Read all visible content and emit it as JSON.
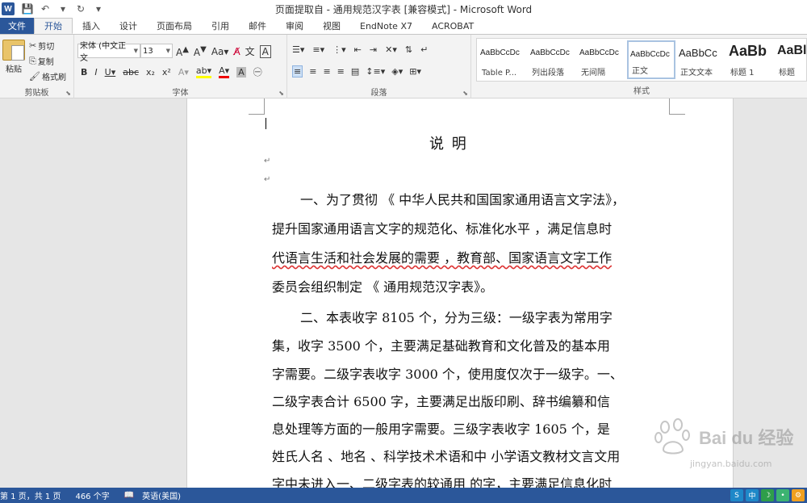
{
  "titlebar": {
    "title": "页面提取自 - 通用规范汉字表 [兼容模式] - Microsoft Word",
    "app_icon": "W"
  },
  "tabs": [
    "文件",
    "开始",
    "插入",
    "设计",
    "页面布局",
    "引用",
    "邮件",
    "审阅",
    "视图",
    "EndNote X7",
    "ACROBAT"
  ],
  "ribbon": {
    "clipboard": {
      "label": "剪贴板",
      "paste": "粘贴",
      "cut": "剪切",
      "copy": "复制",
      "format_painter": "格式刷"
    },
    "font": {
      "label": "字体",
      "font_name": "宋体 (中文正文",
      "font_size": "13"
    },
    "paragraph": {
      "label": "段落"
    },
    "styles": {
      "label": "样式",
      "items": [
        {
          "preview": "AaBbCcDc",
          "name": "Table P..."
        },
        {
          "preview": "AaBbCcDc",
          "name": "列出段落"
        },
        {
          "preview": "AaBbCcDc",
          "name": "无间隔"
        },
        {
          "preview": "AaBbCcDc",
          "name": "正文"
        },
        {
          "preview": "AaBbCc",
          "name": "正文文本"
        },
        {
          "preview": "AaBb",
          "name": "标题 1"
        },
        {
          "preview": "AaBl",
          "name": "标题"
        }
      ]
    }
  },
  "document": {
    "heading": "说    明",
    "para1": [
      "一、为了贯彻      《   中华人民共和国国家通用语言文字法》，",
      "提升国家通用语言文字的规范化、标准化水平          ，满足信息时",
      "代语言生活和社会发展的需要           ，教育部、国家语言文字工作",
      "委员会组织制定     《 通用规范汉字表》。"
    ],
    "para2": [
      "二、本表收字 8105 个，分为三级：一级字表为常用字",
      "集，收字 3500 个，主要满足基础教育和文化普及的基本用",
      "字需要。二级字表收字 3000 个，使用度仅次于一级字。一、",
      "二级字表合计 6500 字，主要满足出版印刷、辞书编纂和信",
      "息处理等方面的一般用字需要。三级字表收字 1605 个，是",
      "姓氏人名 、地名 、科学技术术语和中 小学语文教材文言文用",
      "字中未进入一、二级字表的较通用   的字，主要满足信息化时"
    ]
  },
  "watermark": {
    "text": "Bai du 经验",
    "url": "jingyan.baidu.com"
  },
  "status": {
    "page": "第 1 页，共 1 页",
    "words": "466 个字",
    "language": "英语(美国)"
  },
  "tray": [
    "S",
    "中",
    "☽",
    "•",
    "⚙"
  ],
  "colors": {
    "accent": "#2b579a",
    "tray_s": "#1e88c8",
    "tray_zh": "#1e88c8",
    "tray_moon": "#2e9e4a",
    "tray_dot": "#3cb371",
    "tray_gear": "#f0a020"
  }
}
